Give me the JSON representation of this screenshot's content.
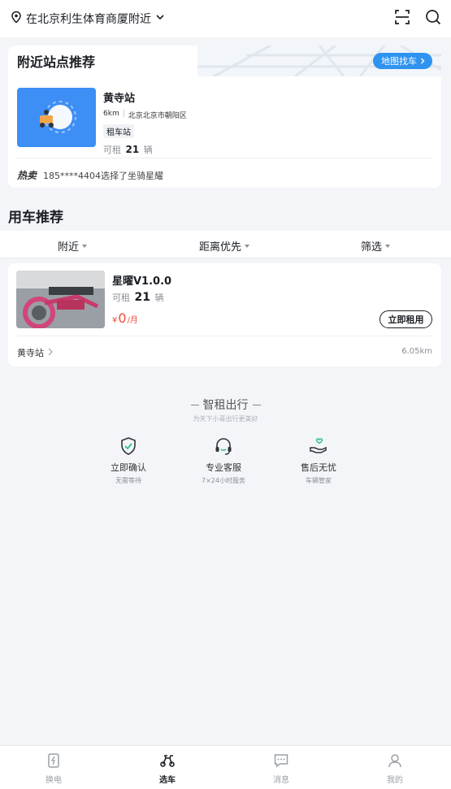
{
  "header": {
    "location_text": "在北京利生体育商厦附近",
    "icons": [
      "location-pin-icon",
      "chevron-down-icon",
      "scan-icon",
      "search-icon"
    ]
  },
  "nearby": {
    "title": "附近站点推荐",
    "map_button_label": "地图找车",
    "station": {
      "name": "黄寺站",
      "distance": "6km",
      "address": "北京北京市朝阳区",
      "tag": "租车站",
      "available_prefix": "可租",
      "available_count": "21",
      "available_unit": "辆"
    },
    "hot_badge": "热卖",
    "hot_text": "185****4404选择了坐骑星耀"
  },
  "recommend": {
    "title": "用车推荐",
    "filters": [
      "附近",
      "距离优先",
      "筛选"
    ]
  },
  "vehicle": {
    "name": "星曜V1.0.0",
    "available_prefix": "可租",
    "available_count": "21",
    "available_unit": "辆",
    "price_symbol": "¥",
    "price_value": "0",
    "price_unit": "/月",
    "rent_button_label": "立即租用",
    "station": "黄寺站",
    "distance": "6.05km"
  },
  "brand": {
    "title": "智租出行",
    "subtitle": "为天下小哥出行更美好"
  },
  "features": [
    {
      "icon": "shield-check-icon",
      "title": "立即确认",
      "subtitle": "无需等待"
    },
    {
      "icon": "headset-icon",
      "title": "专业客服",
      "subtitle": "7×24小时服务"
    },
    {
      "icon": "hand-heart-icon",
      "title": "售后无忧",
      "subtitle": "车辆管家"
    }
  ],
  "tabbar": {
    "active_index": 1,
    "tabs": [
      {
        "label": "换电",
        "icon": "battery-swap-icon"
      },
      {
        "label": "选车",
        "icon": "scooter-icon"
      },
      {
        "label": "消息",
        "icon": "message-icon"
      },
      {
        "label": "我的",
        "icon": "profile-icon"
      }
    ]
  },
  "colors": {
    "accent_blue": "#2f93f0",
    "price_red": "#f04a3a",
    "accent_green": "#2cc38a"
  }
}
